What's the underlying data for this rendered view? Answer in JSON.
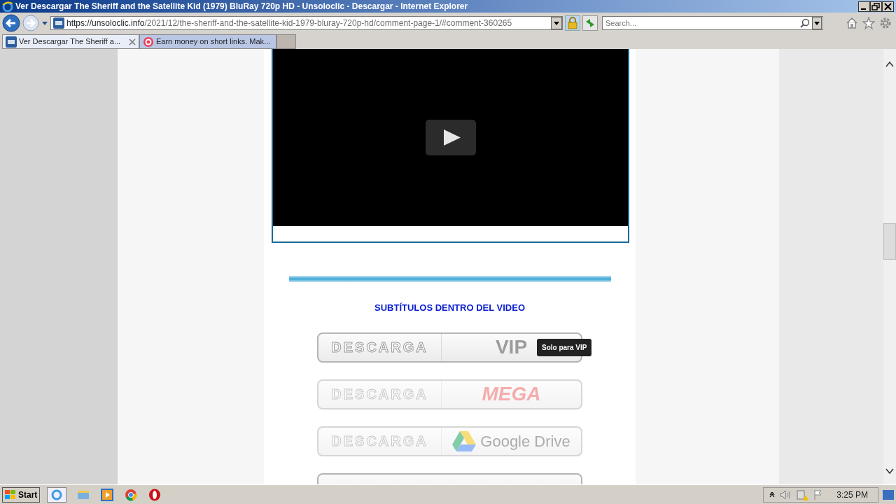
{
  "window": {
    "title": "Ver Descargar The Sheriff and the Satellite Kid (1979) BluRay 720p HD - Unsoloclic - Descargar  - Internet Explorer"
  },
  "address_bar": {
    "url_host": "https://unsoloclic.info",
    "url_path": "/2021/12/the-sheriff-and-the-satellite-kid-1979-bluray-720p-hd/comment-page-1/#comment-360265"
  },
  "search": {
    "placeholder": "Search..."
  },
  "tabs": [
    {
      "label": "Ver Descargar The Sheriff a...",
      "selected": true,
      "kind": "site"
    },
    {
      "label": "Earn money on short links. Mak...",
      "selected": false,
      "kind": "ad"
    }
  ],
  "page": {
    "heading": "SUBTÍTULOS DENTRO DEL VIDEO",
    "downloads": [
      {
        "label": "DESCARGA",
        "kind": "vip",
        "service": "VIP",
        "faded": false,
        "tooltip": "Solo para VIP"
      },
      {
        "label": "DESCARGA",
        "kind": "mega",
        "service": "MEGA",
        "faded": true
      },
      {
        "label": "DESCARGA",
        "kind": "gdrive",
        "service": "Google Drive",
        "faded": true
      },
      {
        "kind": "partial"
      }
    ]
  },
  "taskbar": {
    "start": "Start",
    "clock": "3:25 PM"
  }
}
